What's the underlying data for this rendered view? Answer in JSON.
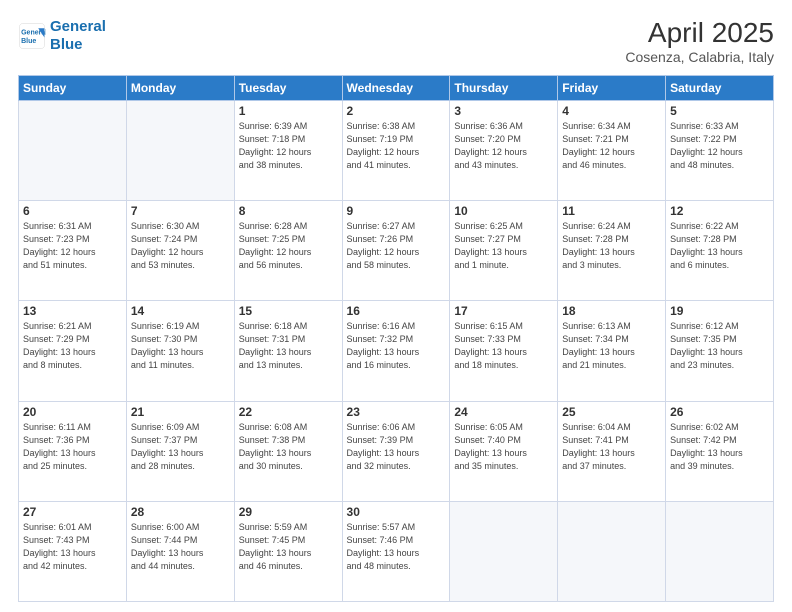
{
  "header": {
    "logo_line1": "General",
    "logo_line2": "Blue",
    "title": "April 2025",
    "subtitle": "Cosenza, Calabria, Italy"
  },
  "days_of_week": [
    "Sunday",
    "Monday",
    "Tuesday",
    "Wednesday",
    "Thursday",
    "Friday",
    "Saturday"
  ],
  "weeks": [
    [
      {
        "day": "",
        "info": ""
      },
      {
        "day": "",
        "info": ""
      },
      {
        "day": "1",
        "info": "Sunrise: 6:39 AM\nSunset: 7:18 PM\nDaylight: 12 hours\nand 38 minutes."
      },
      {
        "day": "2",
        "info": "Sunrise: 6:38 AM\nSunset: 7:19 PM\nDaylight: 12 hours\nand 41 minutes."
      },
      {
        "day": "3",
        "info": "Sunrise: 6:36 AM\nSunset: 7:20 PM\nDaylight: 12 hours\nand 43 minutes."
      },
      {
        "day": "4",
        "info": "Sunrise: 6:34 AM\nSunset: 7:21 PM\nDaylight: 12 hours\nand 46 minutes."
      },
      {
        "day": "5",
        "info": "Sunrise: 6:33 AM\nSunset: 7:22 PM\nDaylight: 12 hours\nand 48 minutes."
      }
    ],
    [
      {
        "day": "6",
        "info": "Sunrise: 6:31 AM\nSunset: 7:23 PM\nDaylight: 12 hours\nand 51 minutes."
      },
      {
        "day": "7",
        "info": "Sunrise: 6:30 AM\nSunset: 7:24 PM\nDaylight: 12 hours\nand 53 minutes."
      },
      {
        "day": "8",
        "info": "Sunrise: 6:28 AM\nSunset: 7:25 PM\nDaylight: 12 hours\nand 56 minutes."
      },
      {
        "day": "9",
        "info": "Sunrise: 6:27 AM\nSunset: 7:26 PM\nDaylight: 12 hours\nand 58 minutes."
      },
      {
        "day": "10",
        "info": "Sunrise: 6:25 AM\nSunset: 7:27 PM\nDaylight: 13 hours\nand 1 minute."
      },
      {
        "day": "11",
        "info": "Sunrise: 6:24 AM\nSunset: 7:28 PM\nDaylight: 13 hours\nand 3 minutes."
      },
      {
        "day": "12",
        "info": "Sunrise: 6:22 AM\nSunset: 7:28 PM\nDaylight: 13 hours\nand 6 minutes."
      }
    ],
    [
      {
        "day": "13",
        "info": "Sunrise: 6:21 AM\nSunset: 7:29 PM\nDaylight: 13 hours\nand 8 minutes."
      },
      {
        "day": "14",
        "info": "Sunrise: 6:19 AM\nSunset: 7:30 PM\nDaylight: 13 hours\nand 11 minutes."
      },
      {
        "day": "15",
        "info": "Sunrise: 6:18 AM\nSunset: 7:31 PM\nDaylight: 13 hours\nand 13 minutes."
      },
      {
        "day": "16",
        "info": "Sunrise: 6:16 AM\nSunset: 7:32 PM\nDaylight: 13 hours\nand 16 minutes."
      },
      {
        "day": "17",
        "info": "Sunrise: 6:15 AM\nSunset: 7:33 PM\nDaylight: 13 hours\nand 18 minutes."
      },
      {
        "day": "18",
        "info": "Sunrise: 6:13 AM\nSunset: 7:34 PM\nDaylight: 13 hours\nand 21 minutes."
      },
      {
        "day": "19",
        "info": "Sunrise: 6:12 AM\nSunset: 7:35 PM\nDaylight: 13 hours\nand 23 minutes."
      }
    ],
    [
      {
        "day": "20",
        "info": "Sunrise: 6:11 AM\nSunset: 7:36 PM\nDaylight: 13 hours\nand 25 minutes."
      },
      {
        "day": "21",
        "info": "Sunrise: 6:09 AM\nSunset: 7:37 PM\nDaylight: 13 hours\nand 28 minutes."
      },
      {
        "day": "22",
        "info": "Sunrise: 6:08 AM\nSunset: 7:38 PM\nDaylight: 13 hours\nand 30 minutes."
      },
      {
        "day": "23",
        "info": "Sunrise: 6:06 AM\nSunset: 7:39 PM\nDaylight: 13 hours\nand 32 minutes."
      },
      {
        "day": "24",
        "info": "Sunrise: 6:05 AM\nSunset: 7:40 PM\nDaylight: 13 hours\nand 35 minutes."
      },
      {
        "day": "25",
        "info": "Sunrise: 6:04 AM\nSunset: 7:41 PM\nDaylight: 13 hours\nand 37 minutes."
      },
      {
        "day": "26",
        "info": "Sunrise: 6:02 AM\nSunset: 7:42 PM\nDaylight: 13 hours\nand 39 minutes."
      }
    ],
    [
      {
        "day": "27",
        "info": "Sunrise: 6:01 AM\nSunset: 7:43 PM\nDaylight: 13 hours\nand 42 minutes."
      },
      {
        "day": "28",
        "info": "Sunrise: 6:00 AM\nSunset: 7:44 PM\nDaylight: 13 hours\nand 44 minutes."
      },
      {
        "day": "29",
        "info": "Sunrise: 5:59 AM\nSunset: 7:45 PM\nDaylight: 13 hours\nand 46 minutes."
      },
      {
        "day": "30",
        "info": "Sunrise: 5:57 AM\nSunset: 7:46 PM\nDaylight: 13 hours\nand 48 minutes."
      },
      {
        "day": "",
        "info": ""
      },
      {
        "day": "",
        "info": ""
      },
      {
        "day": "",
        "info": ""
      }
    ]
  ]
}
